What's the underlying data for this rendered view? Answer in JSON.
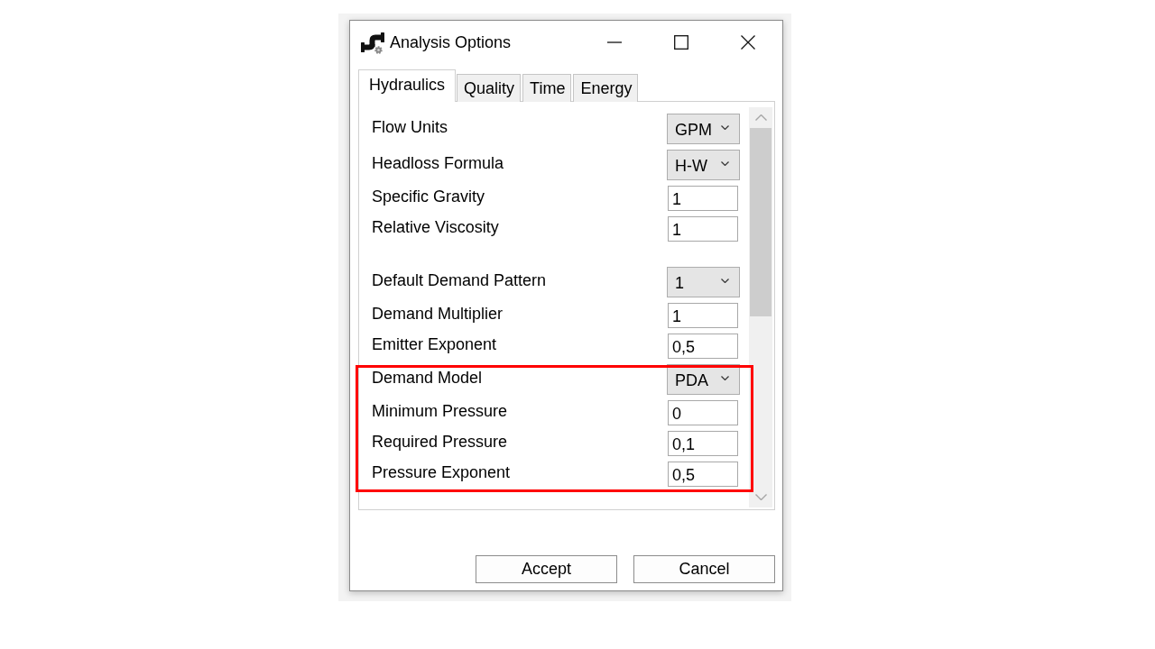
{
  "window": {
    "title": "Analysis Options"
  },
  "tabs": [
    {
      "label": "Hydraulics",
      "selected": true
    },
    {
      "label": "Quality",
      "selected": false
    },
    {
      "label": "Time",
      "selected": false
    },
    {
      "label": "Energy",
      "selected": false
    }
  ],
  "sections": [
    {
      "rows": [
        {
          "label": "Flow Units",
          "kind": "dropdown",
          "value": "GPM",
          "highlighted": false
        },
        {
          "label": "Headloss Formula",
          "kind": "dropdown",
          "value": "H-W",
          "highlighted": false
        },
        {
          "label": "Specific Gravity",
          "kind": "textbox",
          "value": "1",
          "highlighted": false
        },
        {
          "label": "Relative Viscosity",
          "kind": "textbox",
          "value": "1",
          "highlighted": false
        }
      ]
    },
    {
      "rows": [
        {
          "label": "Default Demand Pattern",
          "kind": "dropdown",
          "value": "1",
          "highlighted": false
        },
        {
          "label": "Demand Multiplier",
          "kind": "textbox",
          "value": "1",
          "highlighted": false
        },
        {
          "label": "Emitter Exponent",
          "kind": "textbox",
          "value": "0,5",
          "highlighted": false
        },
        {
          "label": "Demand Model",
          "kind": "dropdown",
          "value": "PDA",
          "highlighted": true
        },
        {
          "label": "Minimum Pressure",
          "kind": "textbox",
          "value": "0",
          "highlighted": true
        },
        {
          "label": "Required Pressure",
          "kind": "textbox",
          "value": "0,1",
          "highlighted": true
        },
        {
          "label": "Pressure Exponent",
          "kind": "textbox",
          "value": "0,5",
          "highlighted": true
        }
      ]
    }
  ],
  "buttons": [
    {
      "label": "Accept"
    },
    {
      "label": "Cancel"
    }
  ]
}
